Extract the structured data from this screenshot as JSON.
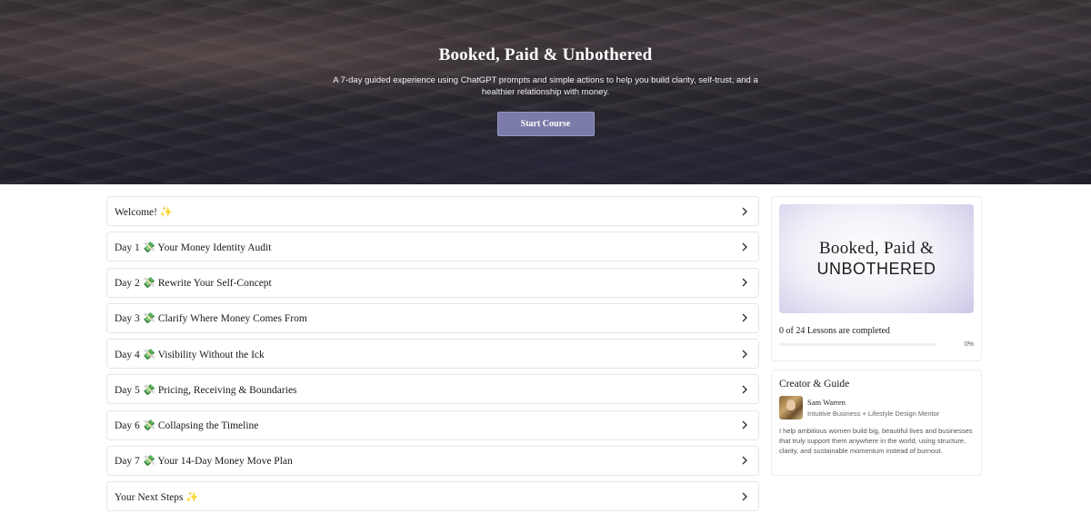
{
  "hero": {
    "title": "Booked, Paid & Unbothered",
    "subtitle": "A 7-day guided experience using ChatGPT prompts and simple actions to help you build clarity, self-trust, and a healthier relationship with money.",
    "start_button": "Start Course"
  },
  "lessons": [
    {
      "title": "Welcome! ✨"
    },
    {
      "title": "Day 1 💸 Your Money Identity Audit"
    },
    {
      "title": "Day 2 💸 Rewrite Your Self-Concept"
    },
    {
      "title": "Day 3 💸 Clarify Where Money Comes From"
    },
    {
      "title": "Day 4 💸 Visibility Without the Ick"
    },
    {
      "title": "Day 5 💸 Pricing, Receiving & Boundaries"
    },
    {
      "title": "Day 6 💸 Collapsing the Timeline"
    },
    {
      "title": "Day 7 💸 Your 14-Day Money Move Plan"
    },
    {
      "title": "Your Next Steps ✨"
    }
  ],
  "course_card": {
    "thumbnail_line1": "Booked, Paid &",
    "thumbnail_line2": "UNBOTHERED",
    "progress_text": "0 of 24 Lessons are completed",
    "progress_percent_label": "0%",
    "progress_fraction": 0
  },
  "creator": {
    "heading": "Creator & Guide",
    "name": "Sam Warren",
    "role": "Intuitive Business + Lifestyle Design Mentor",
    "bio": "I help ambitious women build big, beautiful lives and businesses that truly support them anywhere in the world, using structure, clarity, and sustainable momentum instead of burnout."
  },
  "colors": {
    "accent": "#7a7ba8",
    "border": "#e6e6e6"
  },
  "icons": {
    "lesson_arrow": "chevron-right-icon",
    "sparkle": "sparkles-icon",
    "money": "money-with-wings-icon"
  }
}
